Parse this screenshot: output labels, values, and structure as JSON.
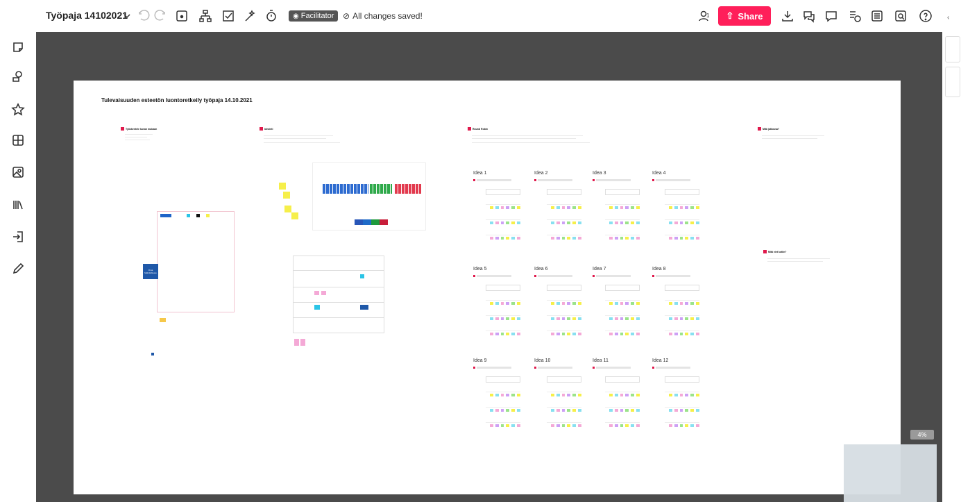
{
  "header": {
    "board_title": "Työpaja 14102021",
    "facilitator_label": "Facilitator",
    "saved_status": "All changes saved!",
    "share_label": "Share",
    "user_count": "1",
    "zoom_level": "4%"
  },
  "board": {
    "heading": "Tulevaisuuden esteetön luontoretkeily työpaja 14.10.2021",
    "ideas": [
      "Idea 1",
      "Idea 2",
      "Idea 3",
      "Idea 4",
      "Idea 5",
      "Idea 6",
      "Idea 7",
      "Idea 8",
      "Idea 9",
      "Idea 10",
      "Idea 11",
      "Idea 12"
    ],
    "mini_labels": {
      "sec1": "Työskentele kuvan mukaan",
      "sec2": "Ideointi",
      "sec3": "Round Robin",
      "sec4": "Mitä jatkossa?",
      "sec5": "Mitä viet kotiin?",
      "blue_card": "Oma Mahdollisuus"
    }
  },
  "colors": {
    "accent": "#ff1f5a",
    "canvas_bg": "#4b4b4b",
    "board_bg": "#ffffff",
    "red_marker": "#e0194c",
    "yellow": "#f6ef4a",
    "blue": "#1f64c8",
    "green": "#1e9a3c",
    "pink": "#f4a9d6",
    "cyan": "#88e0f0",
    "purple": "#cda0f5"
  },
  "icons": [
    "back-icon",
    "sticky-note-icon",
    "shapes-icon",
    "star-icon",
    "frame-icon",
    "image-icon",
    "library-icon",
    "import-icon",
    "pen-icon",
    "chevron-down-icon",
    "undo-icon",
    "redo-icon",
    "frame-tool-icon",
    "org-chart-icon",
    "checklist-icon",
    "magic-wand-icon",
    "timer-icon",
    "check-circle-icon",
    "user-icon",
    "share-upload-icon",
    "download-icon",
    "chat-icon",
    "comment-icon",
    "activity-icon",
    "notes-icon",
    "search-board-icon",
    "help-icon",
    "eye-icon"
  ]
}
